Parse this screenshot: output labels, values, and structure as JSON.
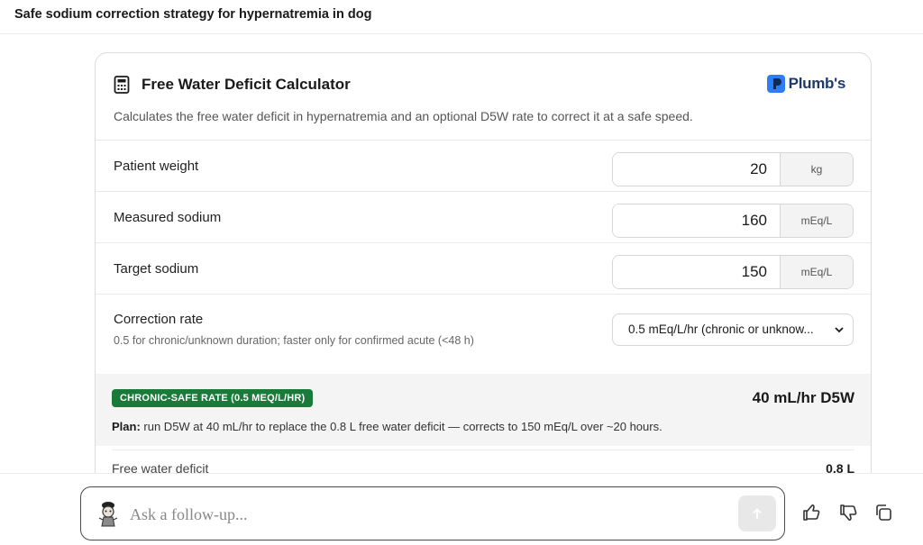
{
  "header": {
    "title": "Safe sodium correction strategy for hypernatremia in dog"
  },
  "card": {
    "title": "Free Water Deficit Calculator",
    "description": "Calculates the free water deficit in hypernatremia and an optional D5W rate to correct it at a safe speed.",
    "brand": "Plumb's",
    "icon": "calculator-icon",
    "fields": [
      {
        "label": "Patient weight",
        "value": "20",
        "unit": "kg"
      },
      {
        "label": "Measured sodium",
        "value": "160",
        "unit": "mEq/L"
      },
      {
        "label": "Target sodium",
        "value": "150",
        "unit": "mEq/L"
      }
    ],
    "correction_rate": {
      "label": "Correction rate",
      "hint": "0.5 for chronic/unknown duration; faster only for confirmed acute (<48 h)",
      "selected": "0.5 mEq/L/hr (chronic or unknow..."
    },
    "result": {
      "badge": "CHRONIC-SAFE RATE (0.5 MEQ/L/HR)",
      "value": "40 mL/hr D5W",
      "plan_label": "Plan:",
      "plan_text": " run D5W at 40 mL/hr to replace the 0.8 L free water deficit — corrects to 150 mEq/L over ~20 hours."
    },
    "deficit": {
      "label": "Free water deficit",
      "value": "0.8 L"
    }
  },
  "chat": {
    "placeholder": "Ask a follow-up..."
  },
  "colors": {
    "badge": "#1a7a3a",
    "brand": "#1d3a6b",
    "brand_mark": "#2f7df6"
  }
}
